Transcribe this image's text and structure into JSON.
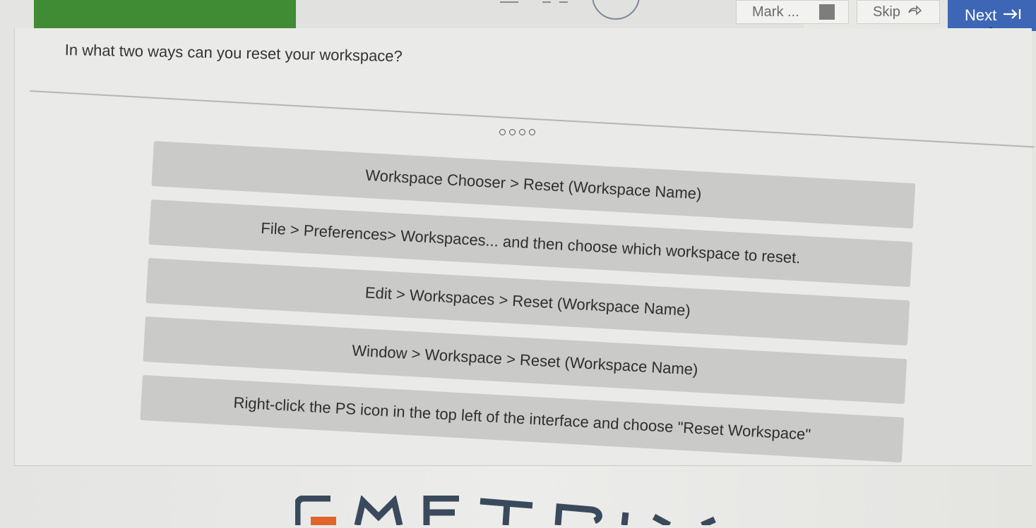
{
  "header": {
    "progress_fraction": 0.34,
    "mark_label": "Mark ...",
    "skip_label": "Skip",
    "skip_icon": "skip-arrow-icon",
    "next_label": "Next",
    "next_icon": "arrow-to-end-icon",
    "accent_color": "#3d67b6",
    "progress_color": "#3f8c35"
  },
  "question": {
    "text": "In what two ways can you reset your workspace?"
  },
  "pager": {
    "dots": 4
  },
  "options": [
    "Workspace Chooser > Reset (Workspace Name)",
    "File > Preferences> Workspaces... and then choose which workspace to reset.",
    "Edit > Workspaces > Reset (Workspace Name)",
    "Window > Workspace > Reset (Workspace Name)",
    "Right-click the PS icon in the top left of the interface and choose \"Reset Workspace\""
  ],
  "footer": {
    "logo_text": "GMETRIX",
    "logo_accent_color": "#e0642b",
    "logo_color": "#3a4a5c"
  }
}
